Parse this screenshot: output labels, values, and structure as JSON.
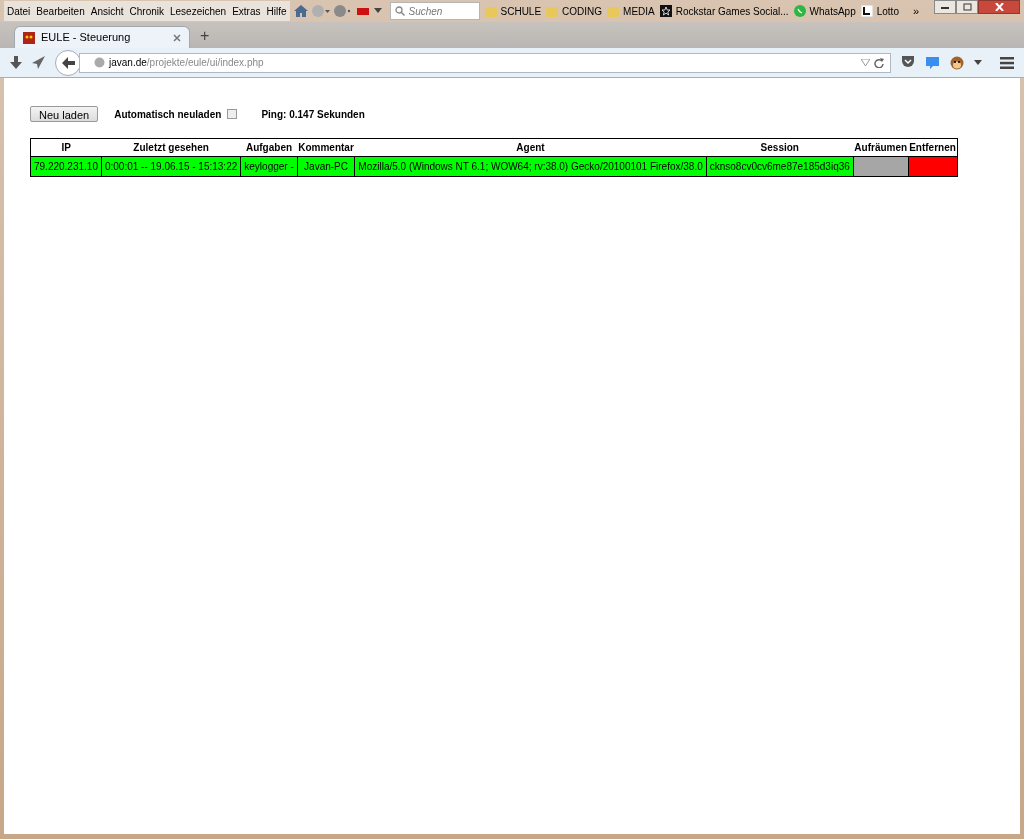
{
  "menu_bar": {
    "items": [
      "Datei",
      "Bearbeiten",
      "Ansicht",
      "Chronik",
      "Lesezeichen",
      "Extras",
      "Hilfe"
    ]
  },
  "search": {
    "placeholder": "Suchen"
  },
  "bookmarks": [
    {
      "kind": "folder",
      "label": "SCHULE"
    },
    {
      "kind": "folder",
      "label": "CODING"
    },
    {
      "kind": "folder",
      "label": "MEDIA"
    },
    {
      "kind": "star",
      "label": "Rockstar Games Social..."
    },
    {
      "kind": "chat",
      "label": "WhatsApp"
    },
    {
      "kind": "letter",
      "label": "Lotto"
    }
  ],
  "bookmarks_overflow": "»",
  "tabs": [
    {
      "title": "EULE - Steuerung",
      "selected": true
    }
  ],
  "new_tab": "+",
  "address": {
    "domain": "javan.de",
    "path": "/projekte/eule/ui/index.php"
  },
  "page": {
    "reload_button": "Neu laden",
    "auto_reload": {
      "label": "Automatisch neuladen",
      "checked": false
    },
    "ping": "Ping: 0.147 Sekunden",
    "table": {
      "columns": [
        "IP",
        "Zuletzt gesehen",
        "Aufgaben",
        "Kommentar",
        "Agent",
        "Session",
        "Aufräumen",
        "Entfernen"
      ],
      "rows": [
        {
          "cells": [
            {
              "kind": "text",
              "text": "79.220.231.10"
            },
            {
              "kind": "text",
              "text": "0:00:01 -- 19.06.15 - 15:13:22"
            },
            {
              "kind": "text",
              "text": "keylogger -"
            },
            {
              "kind": "text",
              "text": "Javan-PC"
            },
            {
              "kind": "text",
              "text": "Mozilla/5.0 (Windows NT 6.1; WOW64; rv:38.0) Gecko/20100101 Firefox/38.0"
            },
            {
              "kind": "text",
              "text": "cknso8cv0cv6me87e185d3iq36"
            },
            {
              "kind": "swatch",
              "color": "#a6a6a6"
            },
            {
              "kind": "swatch",
              "color": "#ff0000"
            }
          ]
        }
      ]
    }
  }
}
